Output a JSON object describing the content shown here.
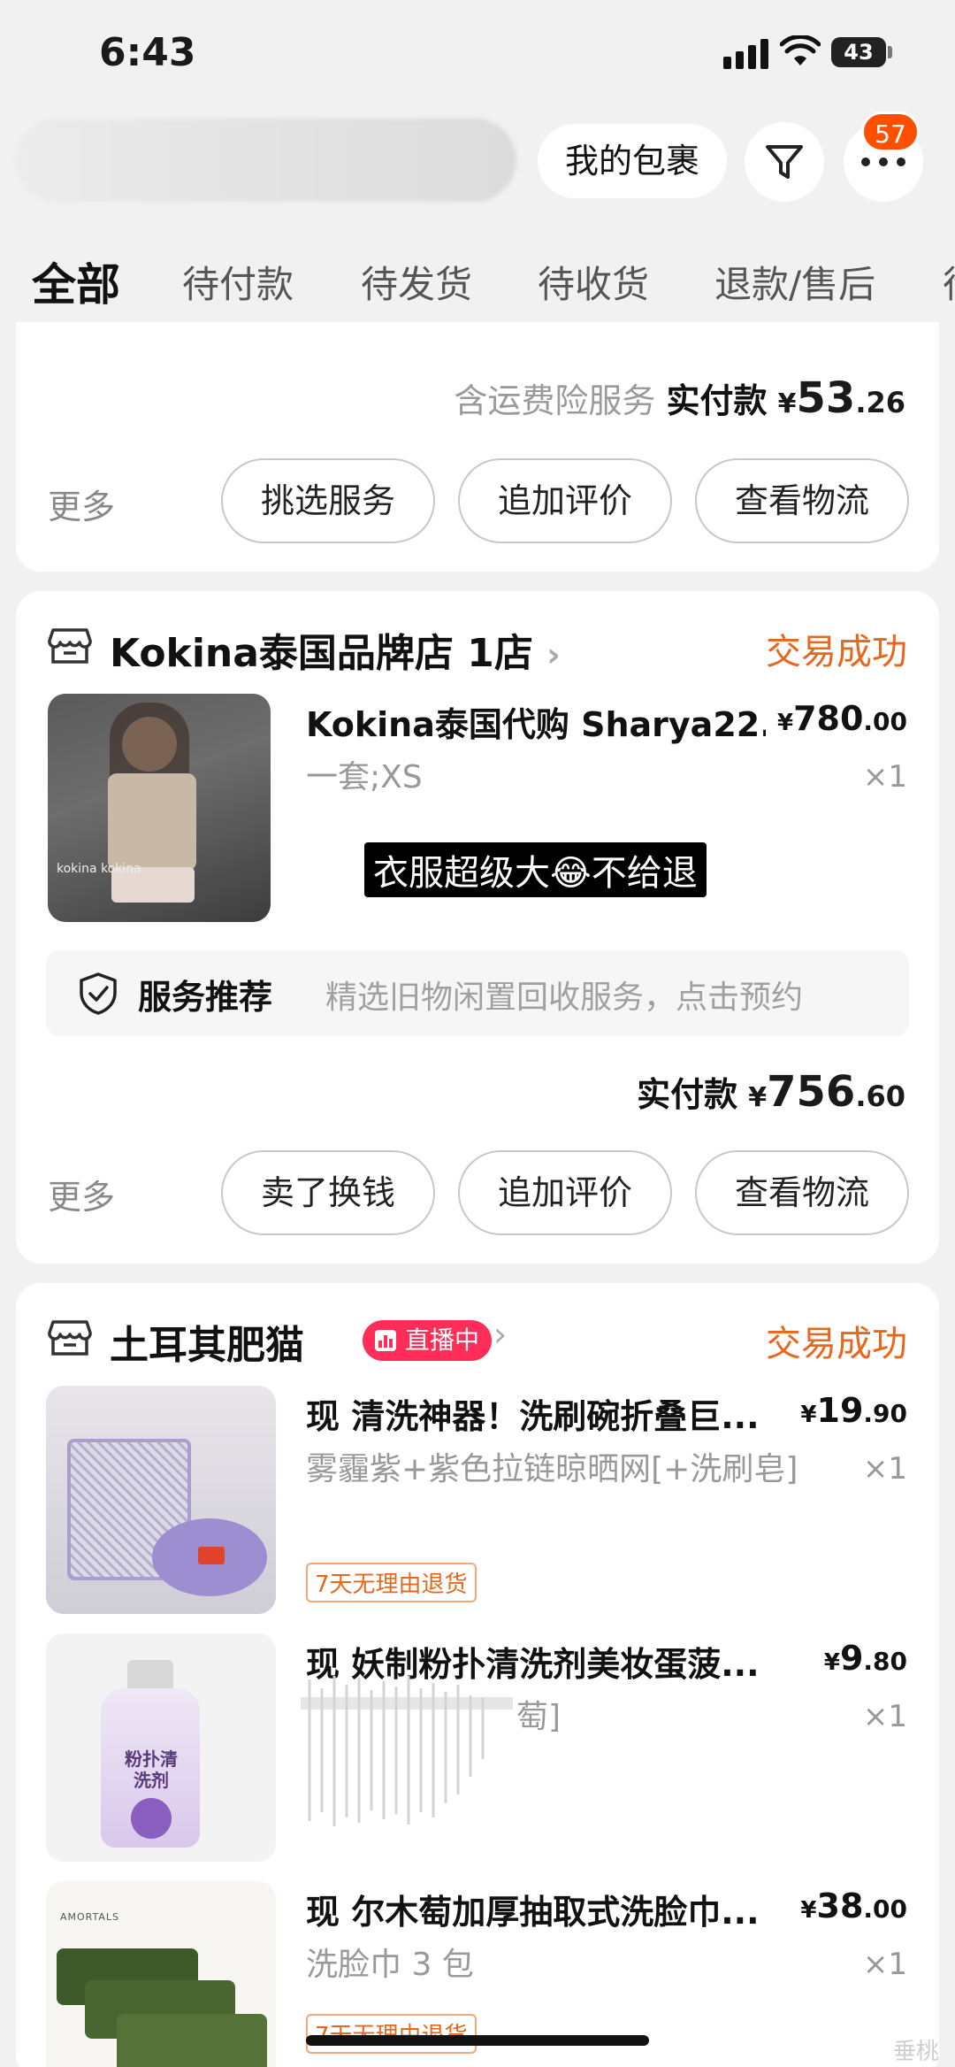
{
  "status_bar": {
    "time": "6:43",
    "battery": "43"
  },
  "header": {
    "packages_button": "我的包裹",
    "notification_count": "57"
  },
  "tabs": [
    "全部",
    "待付款",
    "待发货",
    "待收货",
    "退款/售后",
    "待"
  ],
  "order1": {
    "insurance_note": "含运费险服务",
    "paid_label": "实付款",
    "currency": "¥",
    "paid_int": "53",
    "paid_dec": ".26",
    "more": "更多",
    "buttons": [
      "挑选服务",
      "追加评价",
      "查看物流"
    ]
  },
  "order2": {
    "shop": "Kokina泰国品牌店 1店",
    "status": "交易成功",
    "item": {
      "title": "Kokina泰国代购 Sharya22...",
      "spec": "一套;XS",
      "currency": "¥",
      "price_int": "780",
      "price_dec": ".00",
      "qty": "×1",
      "thumb_text": "kokina kokina"
    },
    "caption": "衣服超级大😂不给退",
    "service": {
      "title": "服务推荐",
      "desc": "精选旧物闲置回收服务，点击预约"
    },
    "paid_label": "实付款",
    "currency": "¥",
    "paid_int": "756",
    "paid_dec": ".60",
    "more": "更多",
    "buttons": [
      "卖了换钱",
      "追加评价",
      "查看物流"
    ]
  },
  "order3": {
    "shop": "土耳其肥猫",
    "live_badge": "直播中",
    "status": "交易成功",
    "items": [
      {
        "title": "现 清洗神器！洗刷碗折叠巨...",
        "spec": "雾霾紫+紫色拉链晾晒网[+洗刷皂]",
        "price_int": "19",
        "price_dec": ".90",
        "qty": "×1",
        "tag": "7天无理由退货"
      },
      {
        "title": "现 妖制粉扑清洗剂美妆蛋菠...",
        "spec": "萄]",
        "price_int": "9",
        "price_dec": ".80",
        "qty": "×1",
        "bottle_text": "粉扑清洗剂"
      },
      {
        "title": "现 尔木萄加厚抽取式洗脸巾...",
        "spec": "洗脸巾 3 包",
        "price_int": "38",
        "price_dec": ".00",
        "qty": "×1",
        "tag": "7天无理由退货",
        "brand": "AMORTALS"
      }
    ],
    "currency": "¥"
  },
  "watermark": "垂桃",
  "colors": {
    "accent": "#ff5000",
    "status": "#e8671b",
    "live": "#ff2d58"
  }
}
